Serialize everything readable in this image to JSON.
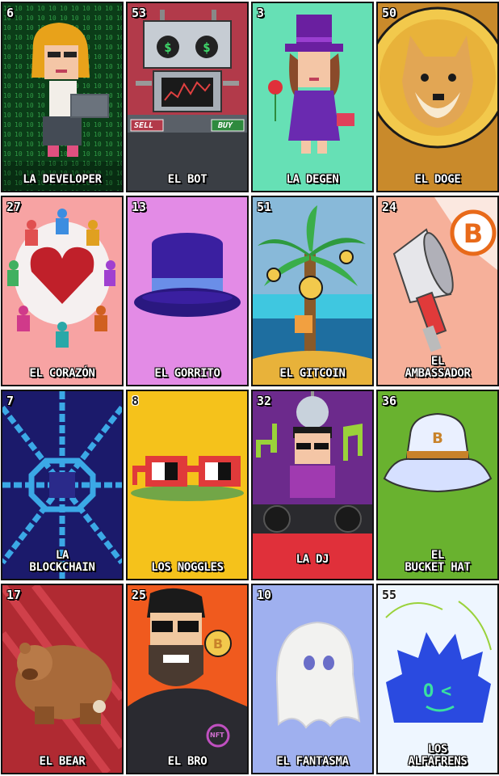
{
  "colors": {
    "developer_bg": "#0b3d18",
    "bot_bg": "#b23a4a",
    "degen_bg": "#66e0b5",
    "doge_bg": "#c98a2b",
    "corazon_bg": "#f7a3a3",
    "gorrito_bg": "#e38be6",
    "gitcoin_bg": "#3fc7e0",
    "ambassador_bg": "#f6b09a",
    "blockchain_bg": "#1b1a6b",
    "noggles_bg": "#f5c21b",
    "dj_bg": "#6c2a8c",
    "bucket_bg": "#69b22f",
    "bear_bg": "#b02a32",
    "bro_bg": "#f05a1e",
    "fantasma_bg": "#9fb0ef",
    "alfafrens_bg": "#eef6ff"
  },
  "cards": [
    {
      "number": "6",
      "title": "LA DEVELOPER",
      "icon": "developer-woman-laptop-icon"
    },
    {
      "number": "53",
      "title": "EL BOT",
      "icon": "trading-robot-icon",
      "sell_label": "SELL",
      "buy_label": "BUY"
    },
    {
      "number": "3",
      "title": "LA DEGEN",
      "icon": "woman-top-hat-rose-icon"
    },
    {
      "number": "50",
      "title": "EL DOGE",
      "icon": "doge-coin-icon"
    },
    {
      "number": "27",
      "title": "EL CORAZÓN",
      "icon": "heart-people-circle-icon"
    },
    {
      "number": "13",
      "title": "EL GORRITO",
      "icon": "top-hat-icon"
    },
    {
      "number": "51",
      "title": "EL GITCOIN",
      "icon": "palm-tree-coins-icon"
    },
    {
      "number": "24",
      "title": "EL\nAMBASSADOR",
      "icon": "megaphone-bitcoin-icon"
    },
    {
      "number": "7",
      "title": "LA\nBLOCKCHAIN",
      "icon": "chain-network-icon"
    },
    {
      "number": "8",
      "title": "LOS NOGGLES",
      "icon": "noggles-glasses-icon"
    },
    {
      "number": "32",
      "title": "LA DJ",
      "icon": "dj-turntables-icon"
    },
    {
      "number": "36",
      "title": "EL\nBUCKET HAT",
      "icon": "bucket-hat-icon"
    },
    {
      "number": "17",
      "title": "EL BEAR",
      "icon": "bear-icon"
    },
    {
      "number": "25",
      "title": "EL BRO",
      "icon": "bearded-bro-coin-icon",
      "shirt_badge": "NFT"
    },
    {
      "number": "10",
      "title": "EL FANTASMA",
      "icon": "ghost-icon"
    },
    {
      "number": "55",
      "title": "LOS\nALFAFRENS",
      "icon": "blue-spiky-creature-icon"
    }
  ]
}
